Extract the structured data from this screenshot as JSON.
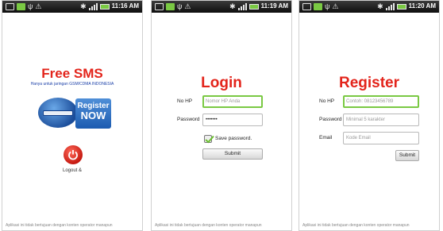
{
  "screens": [
    {
      "clock": "11:16 AM",
      "title": "Free SMS",
      "subtitle": "Hanya untuk jaringan GSM/CDMA INDONESIA",
      "register_button": {
        "line1": "Register",
        "line2": "NOW"
      },
      "logout_label": "Logout &",
      "footer": "Aplikasi ini tidak bertujuan dengan konten operator manapun"
    },
    {
      "clock": "11:19 AM",
      "title": "Login",
      "fields": [
        {
          "label": "No HP",
          "placeholder": "Nomor HP Anda",
          "value": ""
        },
        {
          "label": "Password",
          "placeholder": "",
          "value": "•••••••"
        }
      ],
      "save_password_label": "Save password.",
      "save_password_checked": true,
      "submit_label": "Submit",
      "footer": "Aplikasi ini tidak bertujuan dengan konten operator manapun"
    },
    {
      "clock": "11:20 AM",
      "title": "Register",
      "fields": [
        {
          "label": "No HP",
          "placeholder": "Contoh: 08123456789"
        },
        {
          "label": "Password",
          "placeholder": "Minimal 5 karakter"
        },
        {
          "label": "Email",
          "placeholder": "Kode Email"
        }
      ],
      "submit_label": "Submit",
      "footer": "Aplikasi ini tidak bertujuan dengan konten operator manapun"
    }
  ],
  "colors": {
    "title_red": "#e3241b",
    "focus_green": "#7ac943",
    "brand_blue": "#1c5bb0"
  }
}
